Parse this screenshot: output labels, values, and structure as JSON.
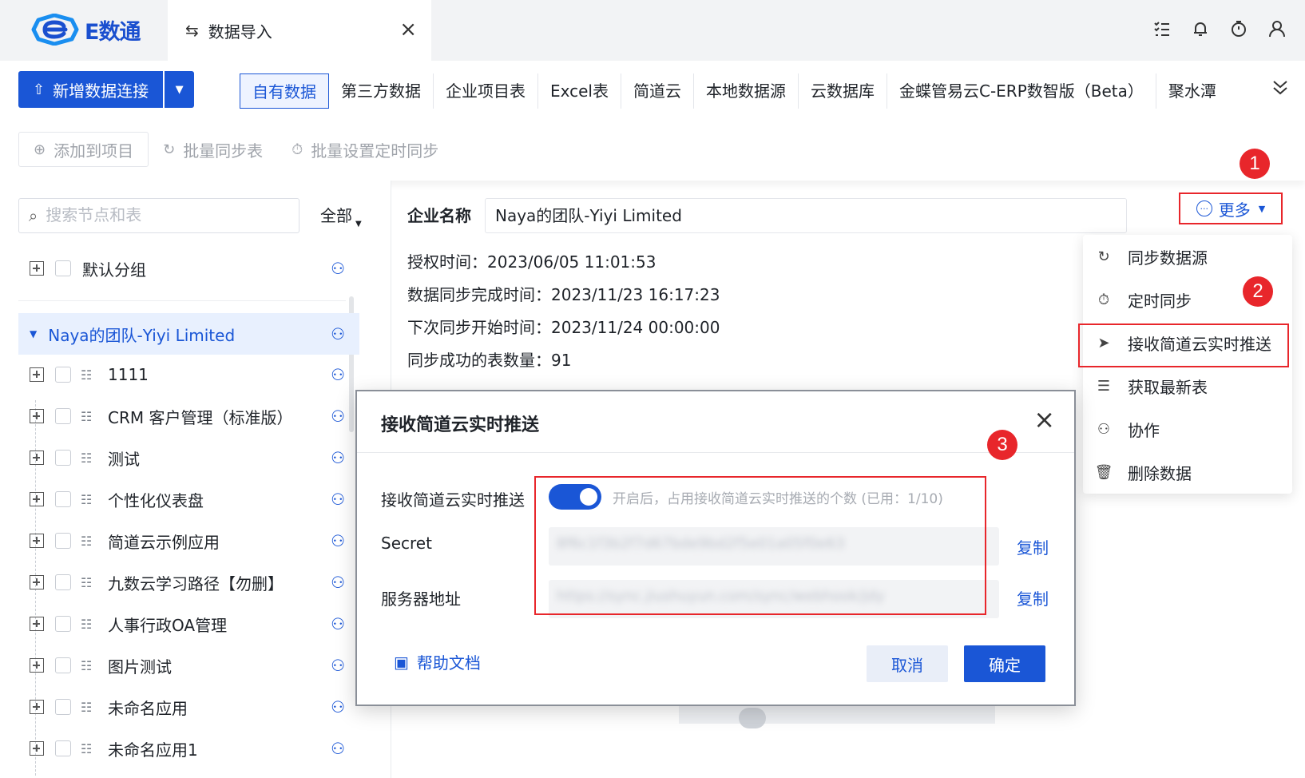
{
  "app": {
    "name": "E数通"
  },
  "tab": {
    "title": "数据导入"
  },
  "toolbar": {
    "add_connection": "新增数据连接",
    "sources": [
      "自有数据",
      "第三方数据",
      "企业项目表",
      "Excel表",
      "简道云",
      "本地数据源",
      "云数据库",
      "金蝶管易云C-ERP数智版（Beta）",
      "聚水潭"
    ],
    "actions": [
      "添加到项目",
      "批量同步表",
      "批量设置定时同步"
    ]
  },
  "sidebar": {
    "search_placeholder": "搜索节点和表",
    "filter": "全部",
    "default_group": "默认分组",
    "selected_node": "Naya的团队-Yiyi Limited",
    "items": [
      "1111",
      "CRM 客户管理（标准版）",
      "测试",
      "个性化仪表盘",
      "简道云示例应用",
      "九数云学习路径【勿删】",
      "人事行政OA管理",
      "图片测试",
      "未命名应用",
      "未命名应用1"
    ]
  },
  "detail": {
    "enterprise_label": "企业名称",
    "enterprise_value": "Naya的团队-Yiyi Limited",
    "more": "更多",
    "lines": [
      "授权时间：2023/06/05 11:01:53",
      "数据同步完成时间：2023/11/23 16:17:23",
      "下次同步开始时间：2023/11/24 00:00:00",
      "同步成功的表数量：91"
    ]
  },
  "more_menu": [
    "同步数据源",
    "定时同步",
    "接收简道云实时推送",
    "获取最新表",
    "协作",
    "删除数据"
  ],
  "badges": [
    "1",
    "2",
    "3"
  ],
  "modal": {
    "title": "接收简道云实时推送",
    "toggle_label": "接收简道云实时推送",
    "toggle_on": true,
    "toggle_hint": "开启后，占用接收简道云实时推送的个数 (已用：1/10)",
    "secret_label": "Secret",
    "secret_value": "8f6c1f3b2f7d67bde9bd2f5e01a05f0e63",
    "server_label": "服务器地址",
    "server_value": "https://sync.jiushuyun.com/sync/webhook/jdy",
    "copy": "复制",
    "help": "帮助文档",
    "cancel": "取消",
    "ok": "确定"
  }
}
